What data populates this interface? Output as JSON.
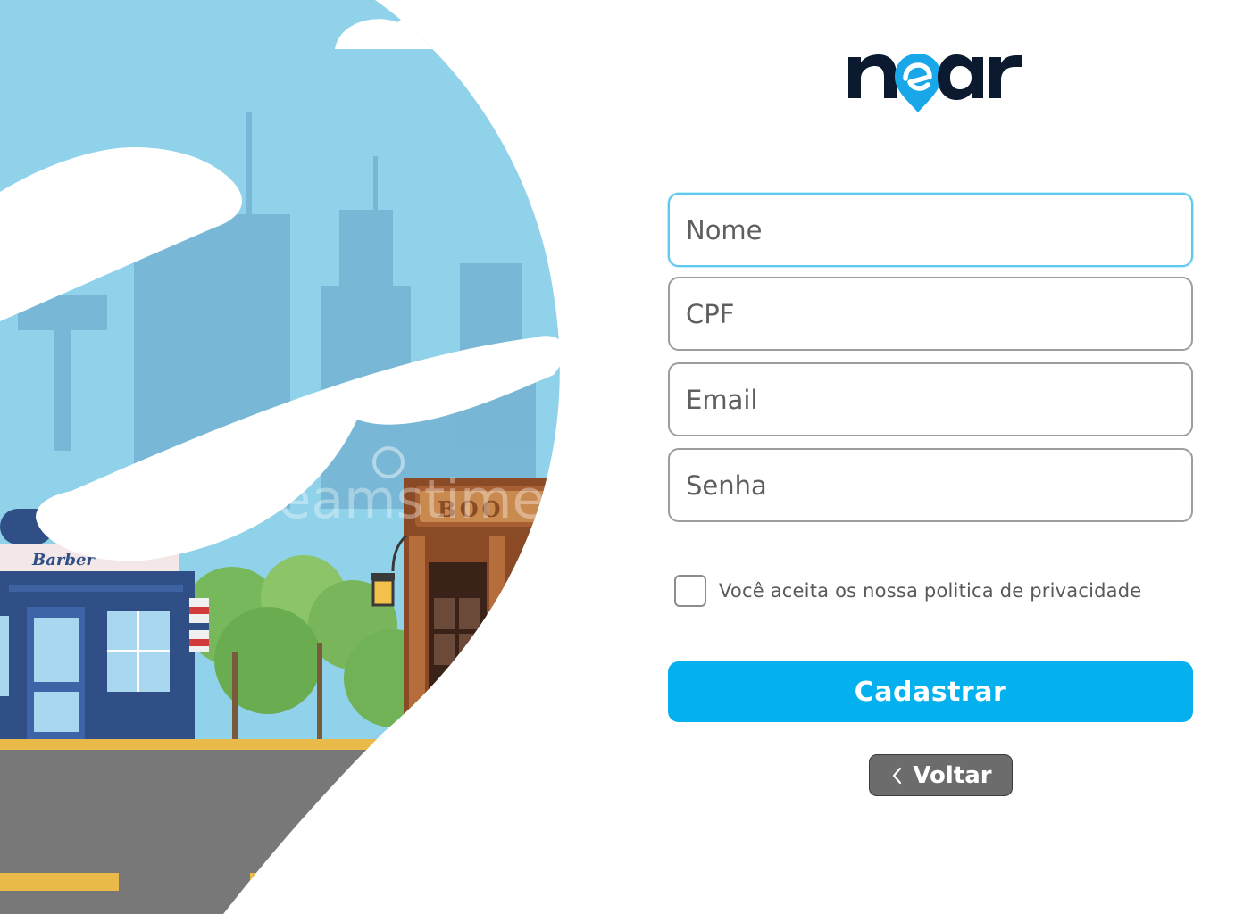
{
  "brand": {
    "logo_text": "near",
    "logo_accent": "#1aa7ea",
    "logo_dark": "#0b1a2e"
  },
  "form": {
    "name_placeholder": "Nome",
    "cpf_placeholder": "CPF",
    "email_placeholder": "Email",
    "password_placeholder": "Senha",
    "consent_label": "Você aceita os nossa politica de privacidade",
    "consent_checked": false,
    "submit_label": "Cadastrar",
    "back_label": "Voltar"
  },
  "illustration": {
    "barber_sign": "Barber",
    "book_sign": "BOO",
    "watermark": "dreamstime"
  },
  "colors": {
    "primary": "#04b1ee",
    "focus_border": "#5bc8ef",
    "back_button": "#6c6c6c",
    "field_border": "#9d9d9d"
  },
  "icons": {
    "back": "chevron-left-icon",
    "logo_pin": "map-pin-icon"
  }
}
